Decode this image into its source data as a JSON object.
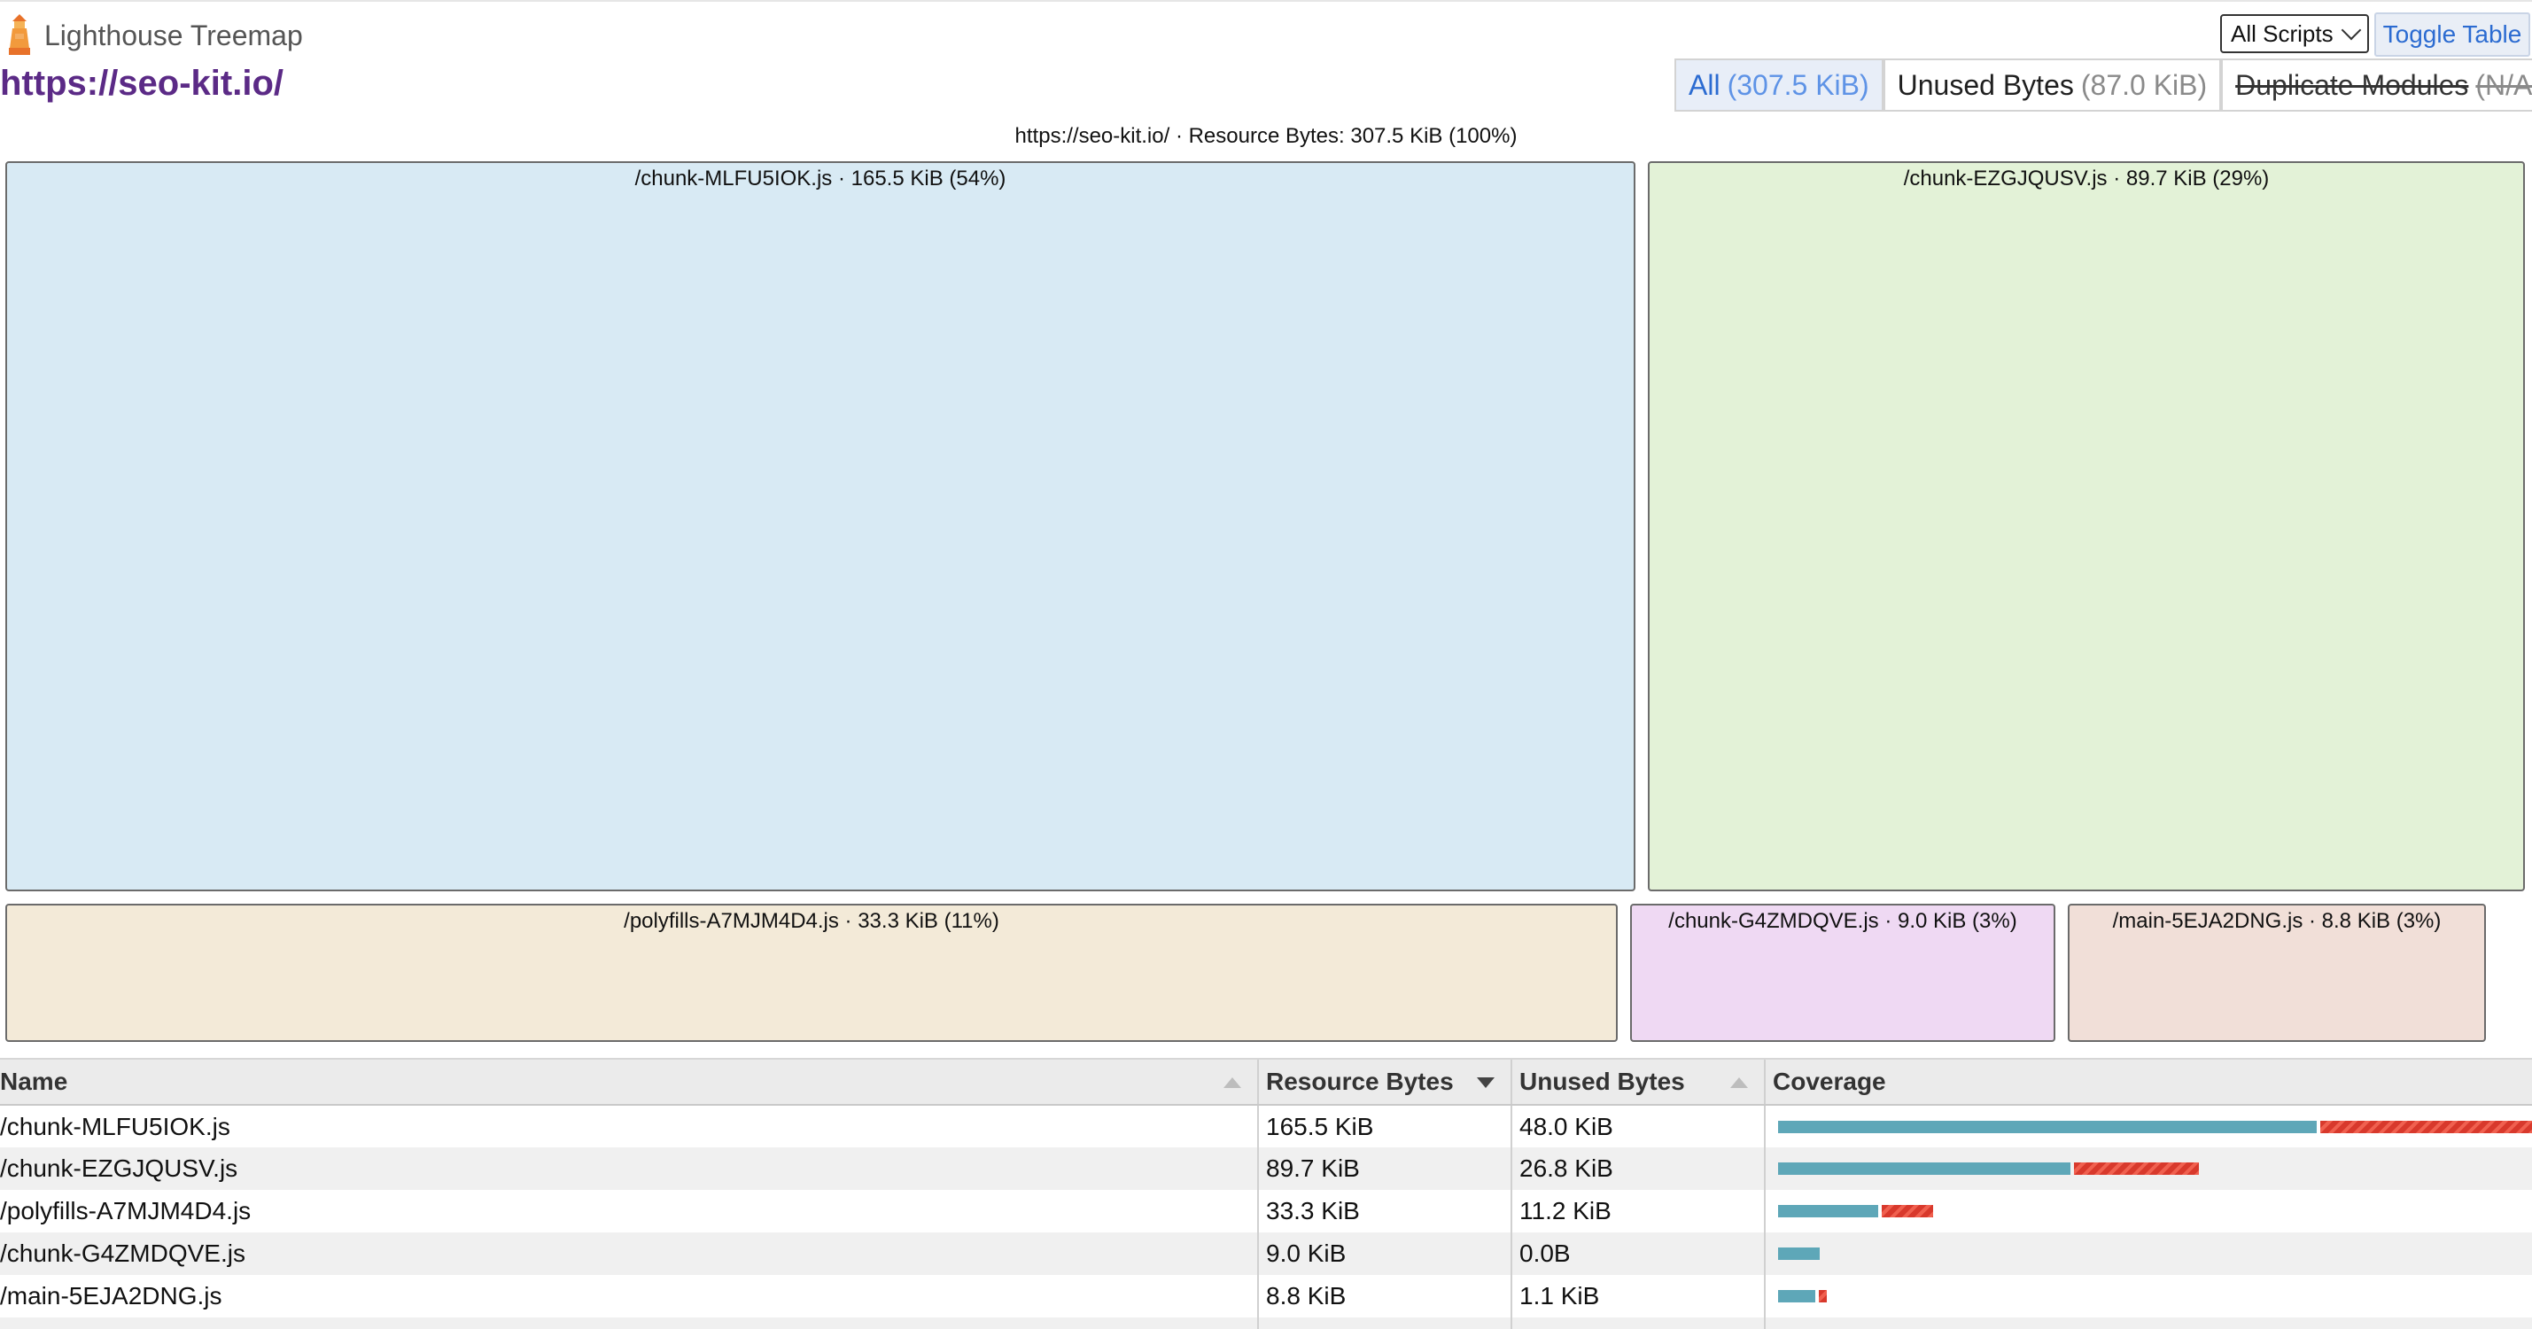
{
  "app": {
    "name": "Lighthouse Treemap",
    "logo_icon": "lighthouse-icon"
  },
  "header": {
    "url": "https://seo-kit.io/",
    "filter_select": {
      "value": "All Scripts"
    },
    "toggle_table_label": "Toggle Table",
    "modes": [
      {
        "label": "All",
        "value": "(307.5 KiB)",
        "active": true,
        "strikethrough": false
      },
      {
        "label": "Unused Bytes",
        "value": "(87.0 KiB)",
        "active": false,
        "strikethrough": false
      },
      {
        "label": "Duplicate Modules",
        "value": "(N/A)",
        "active": false,
        "strikethrough": true
      }
    ]
  },
  "treemap": {
    "root_label": "https://seo-kit.io/ · Resource Bytes: 307.5 KiB (100%)",
    "nodes": [
      {
        "label": "/chunk-MLFU5IOK.js · 165.5 KiB (54%)",
        "color": "#d8eaf4"
      },
      {
        "label": "/chunk-EZGJQUSV.js · 89.7 KiB (29%)",
        "color": "#e3f2d7"
      },
      {
        "label": "/polyfills-A7MJM4D4.js · 33.3 KiB (11%)",
        "color": "#f3ead8"
      },
      {
        "label": "/chunk-G4ZMDQVE.js · 9.0 KiB (3%)",
        "color": "#efd9f3"
      },
      {
        "label": "/main-5EJA2DNG.js · 8.8 KiB (3%)",
        "color": "#f1dfd8"
      }
    ]
  },
  "table": {
    "columns": [
      "Name",
      "Resource Bytes",
      "Unused Bytes",
      "Coverage"
    ],
    "rows": [
      {
        "name": "/chunk-MLFU5IOK.js",
        "resource": "165.5 KiB",
        "unused": "48.0 KiB",
        "coverage": {
          "used_fraction": 0.71,
          "unused_fraction": 0.29,
          "scale": 1.0
        }
      },
      {
        "name": "/chunk-EZGJQUSV.js",
        "resource": "89.7 KiB",
        "unused": "26.8 KiB",
        "coverage": {
          "used_fraction": 0.7,
          "unused_fraction": 0.3,
          "scale": 0.55
        }
      },
      {
        "name": "/polyfills-A7MJM4D4.js",
        "resource": "33.3 KiB",
        "unused": "11.2 KiB",
        "coverage": {
          "used_fraction": 0.66,
          "unused_fraction": 0.34,
          "scale": 0.2
        }
      },
      {
        "name": "/chunk-G4ZMDQVE.js",
        "resource": "9.0 KiB",
        "unused": "0.0B",
        "coverage": {
          "used_fraction": 1.0,
          "unused_fraction": 0.0,
          "scale": 0.055
        }
      },
      {
        "name": "/main-5EJA2DNG.js",
        "resource": "8.8 KiB",
        "unused": "1.1 KiB",
        "coverage": {
          "used_fraction": 0.82,
          "unused_fraction": 0.18,
          "scale": 0.06
        }
      }
    ]
  },
  "colors": {
    "accent": "#2b6bd1",
    "url": "#5b2a86",
    "used": "#5ea7b8",
    "unused": "#d8392c"
  }
}
